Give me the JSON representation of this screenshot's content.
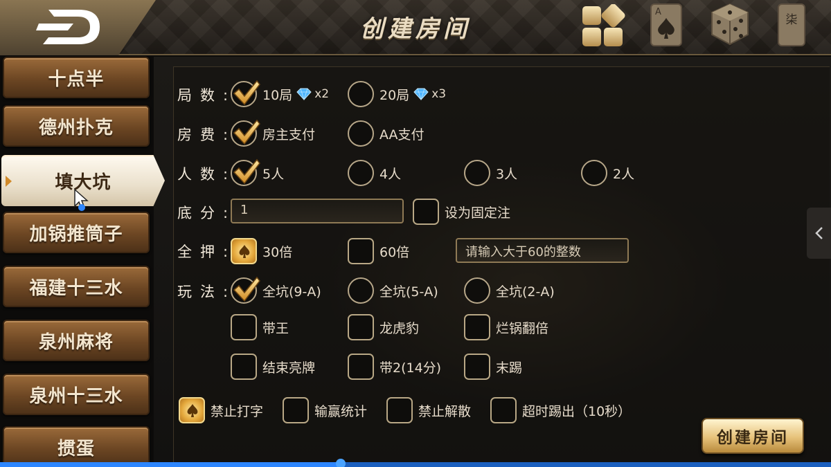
{
  "header": {
    "title": "创建房间",
    "icons": [
      "back-logo-icon",
      "grid-menu-icon",
      "ace-spade-card-icon",
      "dice-icon",
      "tile-qi-icon"
    ],
    "tile_char": "柒",
    "card_letter": "A"
  },
  "sidebar": {
    "items": [
      {
        "label": "十点半",
        "active": false
      },
      {
        "label": "德州扑克",
        "active": false
      },
      {
        "label": "填大坑",
        "active": true
      },
      {
        "label": "加锅推筒子",
        "active": false
      },
      {
        "label": "福建十三水",
        "active": false
      },
      {
        "label": "泉州麻将",
        "active": false
      },
      {
        "label": "泉州十三水",
        "active": false
      },
      {
        "label": "掼蛋",
        "active": false
      }
    ]
  },
  "form": {
    "rounds": {
      "label": "局",
      "label2": "数",
      "options": [
        {
          "text": "10局",
          "cost": "x2",
          "checked": true
        },
        {
          "text": "20局",
          "cost": "x3",
          "checked": false
        }
      ]
    },
    "fee": {
      "label": "房",
      "label2": "费",
      "options": [
        {
          "text": "房主支付",
          "checked": true
        },
        {
          "text": "AA支付",
          "checked": false
        }
      ]
    },
    "players": {
      "label": "人",
      "label2": "数",
      "options": [
        {
          "text": "5人",
          "checked": true
        },
        {
          "text": "4人",
          "checked": false
        },
        {
          "text": "3人",
          "checked": false
        },
        {
          "text": "2人",
          "checked": false
        }
      ]
    },
    "base": {
      "label": "底",
      "label2": "分",
      "value": "1",
      "fixed_label": "设为固定注",
      "fixed_checked": false
    },
    "allin": {
      "label": "全",
      "label2": "押",
      "options": [
        {
          "text": "30倍",
          "checked": true
        },
        {
          "text": "60倍",
          "checked": false
        }
      ],
      "placeholder": "请输入大于60的整数"
    },
    "play": {
      "label": "玩",
      "label2": "法",
      "radios": [
        {
          "text": "全坑(9-A)",
          "checked": true
        },
        {
          "text": "全坑(5-A)",
          "checked": false
        },
        {
          "text": "全坑(2-A)",
          "checked": false
        }
      ],
      "boxes": [
        {
          "text": "带王",
          "checked": false
        },
        {
          "text": "龙虎豹",
          "checked": false
        },
        {
          "text": "烂锅翻倍",
          "checked": false
        },
        {
          "text": "结束亮牌",
          "checked": false
        },
        {
          "text": "带2(14分)",
          "checked": false
        },
        {
          "text": "末踢",
          "checked": false
        }
      ]
    },
    "extras": [
      {
        "text": "禁止打字",
        "checked": true
      },
      {
        "text": "输赢统计",
        "checked": false
      },
      {
        "text": "禁止解散",
        "checked": false
      },
      {
        "text": "超时踢出（10秒）",
        "checked": false
      }
    ],
    "colon": ":"
  },
  "create_button": "创建房间",
  "video_progress": 0.41,
  "colors": {
    "accent_gold": "#e4a83c",
    "wood": "#6c4623",
    "progress_blue": "#2d86ff"
  }
}
